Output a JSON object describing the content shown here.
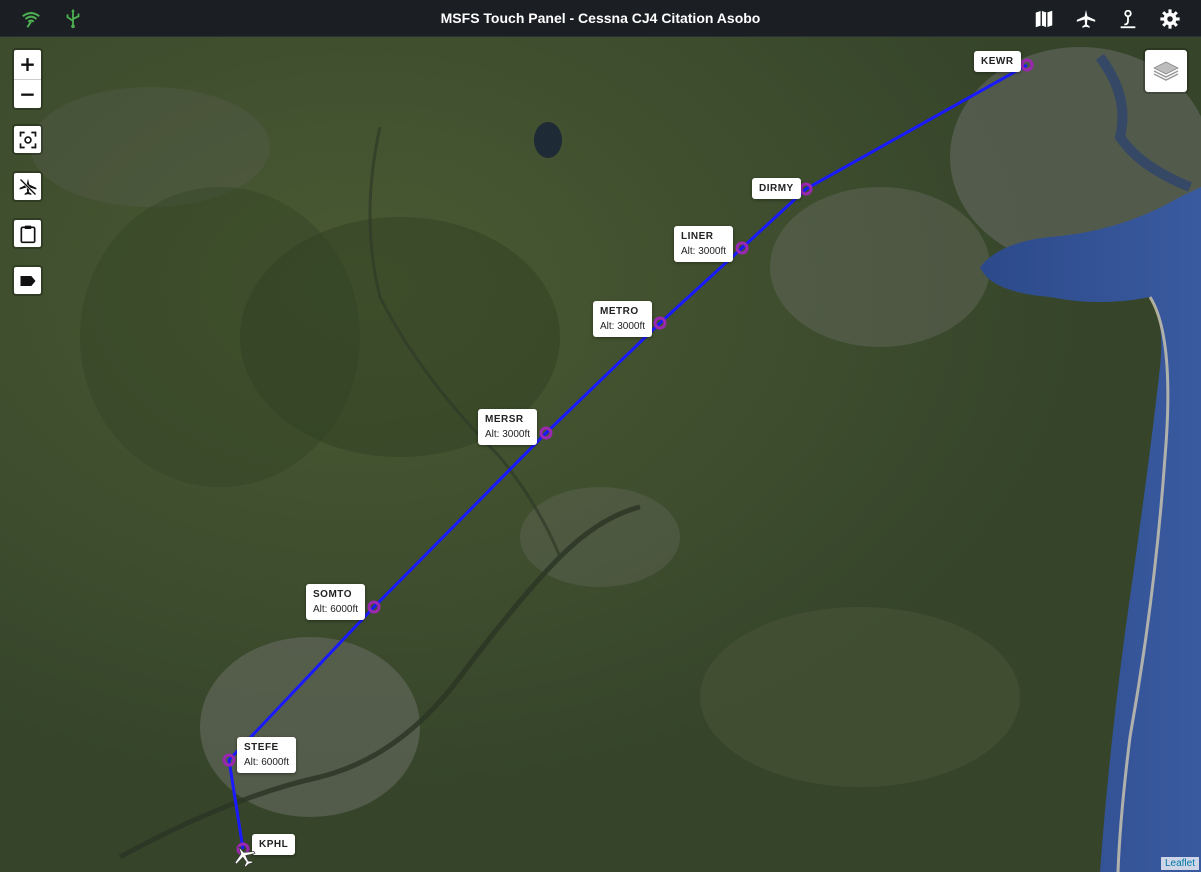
{
  "app": {
    "title": "MSFS Touch Panel - Cessna CJ4 Citation Asobo"
  },
  "topbar": {
    "left_icons": [
      "wifi-signal-icon",
      "usb-icon"
    ],
    "right_icons": [
      "map-icon",
      "airplane-icon",
      "route-icon",
      "gear-icon"
    ],
    "accent": "#4caf50"
  },
  "map_controls": {
    "zoom_in": "+",
    "zoom_out": "−",
    "buttons": [
      "center-focus-icon",
      "airplane-off-icon",
      "clipboard-icon",
      "label-icon"
    ]
  },
  "attribution": "Leaflet",
  "route_color": "#1a1aff",
  "waypoint_color": "#9c27b0",
  "waypoints": [
    {
      "name": "KEWR",
      "alt": ""
    },
    {
      "name": "DIRMY",
      "alt": ""
    },
    {
      "name": "LINER",
      "alt": "Alt: 3000ft"
    },
    {
      "name": "METRO",
      "alt": "Alt: 3000ft"
    },
    {
      "name": "MERSR",
      "alt": "Alt: 3000ft"
    },
    {
      "name": "SOMTO",
      "alt": "Alt: 6000ft"
    },
    {
      "name": "STEFE",
      "alt": "Alt: 6000ft"
    },
    {
      "name": "KPHL",
      "alt": ""
    }
  ]
}
